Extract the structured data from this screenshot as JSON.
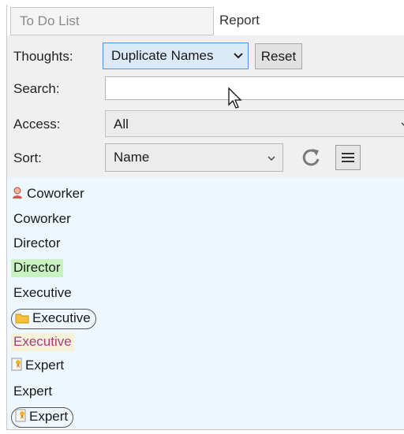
{
  "tabs": {
    "todo": "To Do List",
    "report": "Report"
  },
  "thoughts": {
    "label": "Thoughts:",
    "value": "Duplicate Names"
  },
  "reset_label": "Reset",
  "search": {
    "label": "Search:",
    "value": ""
  },
  "access": {
    "label": "Access:",
    "value": "All"
  },
  "sort": {
    "label": "Sort:",
    "value": "Name"
  },
  "colors": {
    "accent_blue": "#4f94d4",
    "green_highlight": "#c8f2c0",
    "purple_text": "#b0388c",
    "list_background": "#eef7fd"
  },
  "items": [
    {
      "label": "Coworker",
      "icon": "person-icon"
    },
    {
      "label": "Coworker"
    },
    {
      "label": "Director"
    },
    {
      "label": "Director",
      "highlight": "green"
    },
    {
      "label": "Executive"
    },
    {
      "label": "Executive",
      "icon": "folder-icon",
      "outlined": true
    },
    {
      "label": "Executive",
      "highlight": "purple"
    },
    {
      "label": "Expert",
      "icon": "certificate-icon"
    },
    {
      "label": "Expert"
    },
    {
      "label": "Expert",
      "icon": "certificate-icon",
      "outlined": true
    }
  ]
}
